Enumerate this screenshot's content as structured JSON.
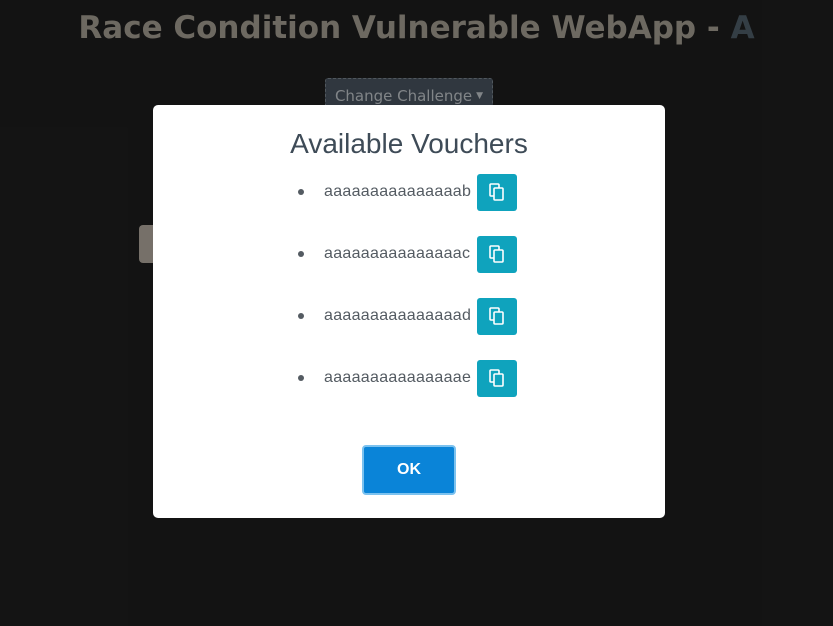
{
  "app": {
    "title_main": "Race Condition Vulnerable WebApp - ",
    "title_accent": "A",
    "change_challenge_label": "Change Challenge"
  },
  "modal": {
    "title": "Available Vouchers",
    "vouchers": [
      {
        "code": "aaaaaaaaaaaaaaab"
      },
      {
        "code": "aaaaaaaaaaaaaaac"
      },
      {
        "code": "aaaaaaaaaaaaaaad"
      },
      {
        "code": "aaaaaaaaaaaaaaae"
      }
    ],
    "copy_icon": "copy-icon",
    "ok_label": "OK"
  },
  "colors": {
    "background": "#1e1e1e",
    "copy_button": "#0fa3bd",
    "ok_button": "#0a84d8"
  }
}
